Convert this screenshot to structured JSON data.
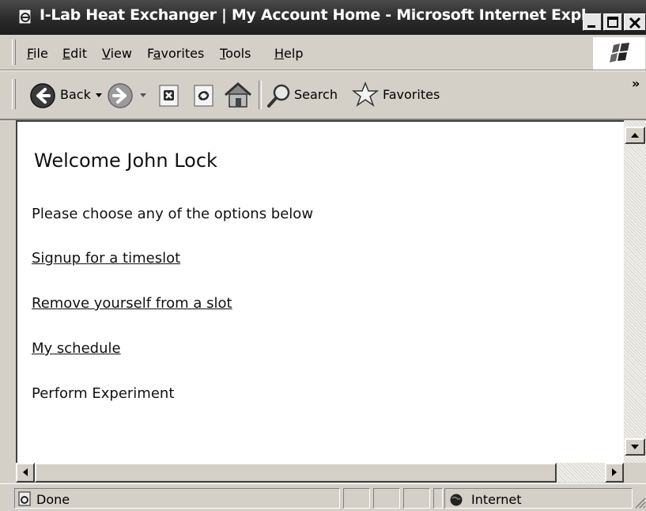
{
  "window": {
    "title": "I-Lab Heat Exchanger | My Account Home - Microsoft Internet Expl..."
  },
  "menu": {
    "items": [
      {
        "label": "File",
        "accel": "F",
        "rest": "ile"
      },
      {
        "label": "Edit",
        "accel": "E",
        "rest": "dit"
      },
      {
        "label": "View",
        "accel": "V",
        "rest": "iew"
      },
      {
        "label": "Favorites",
        "accel": "a",
        "pre": "F",
        "rest": "vorites"
      },
      {
        "label": "Tools",
        "accel": "T",
        "rest": "ools"
      },
      {
        "label": "Help",
        "accel": "H",
        "rest": "elp"
      }
    ]
  },
  "toolbar": {
    "back_label": "Back",
    "search_label": "Search",
    "favorites_label": "Favorites",
    "more": "»"
  },
  "page": {
    "welcome": "Welcome John Lock",
    "intro": "Please choose any of the options below",
    "options": [
      {
        "label": "Signup for a timeslot",
        "is_link": true
      },
      {
        "label": "Remove yourself from a slot",
        "is_link": true
      },
      {
        "label": "My schedule",
        "is_link": true
      },
      {
        "label": "Perform Experiment",
        "is_link": false
      }
    ]
  },
  "status": {
    "text": "Done",
    "zone": "Internet"
  }
}
